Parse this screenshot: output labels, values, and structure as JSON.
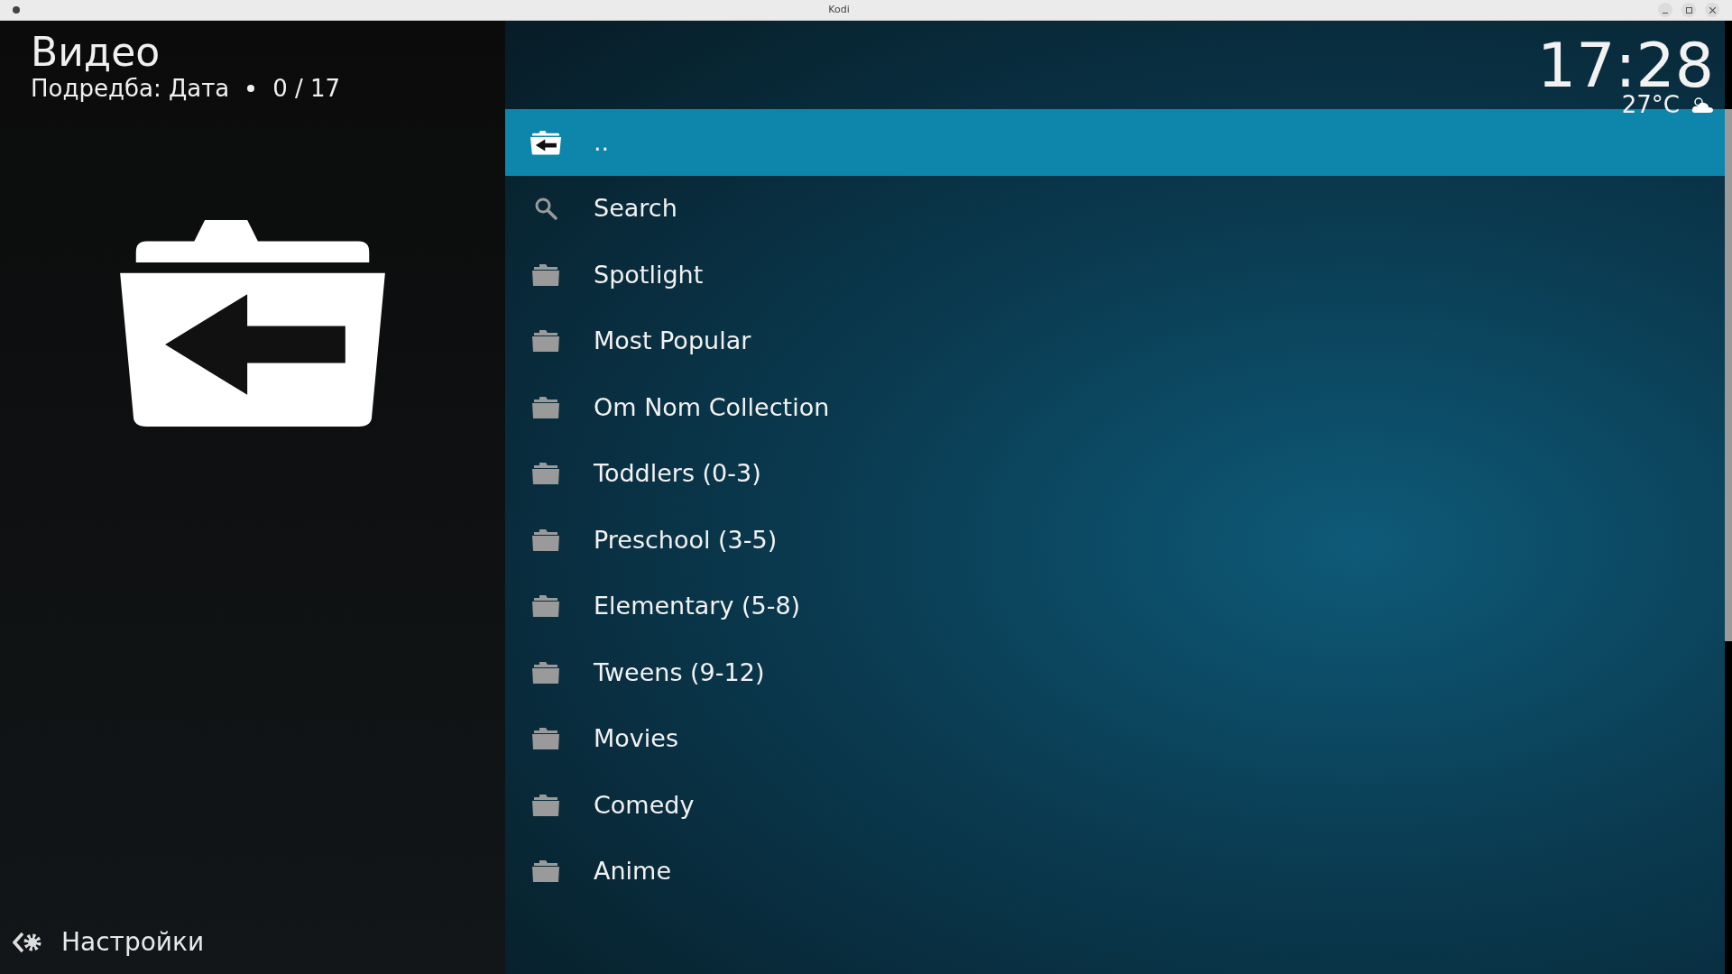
{
  "window": {
    "title": "Kodi"
  },
  "header": {
    "title": "Видео",
    "sort": "Подредба: Дата",
    "count": "0 / 17"
  },
  "clock": {
    "time": "17:28",
    "temperature": "27°C"
  },
  "items": [
    {
      "label": "..",
      "kind": "parent",
      "selected": true
    },
    {
      "label": "Search",
      "kind": "search",
      "selected": false
    },
    {
      "label": "Spotlight",
      "kind": "folder",
      "selected": false
    },
    {
      "label": "Most Popular",
      "kind": "folder",
      "selected": false
    },
    {
      "label": "Om Nom Collection",
      "kind": "folder",
      "selected": false
    },
    {
      "label": "Toddlers (0-3)",
      "kind": "folder",
      "selected": false
    },
    {
      "label": "Preschool (3-5)",
      "kind": "folder",
      "selected": false
    },
    {
      "label": "Elementary (5-8)",
      "kind": "folder",
      "selected": false
    },
    {
      "label": "Tweens (9-12)",
      "kind": "folder",
      "selected": false
    },
    {
      "label": "Movies",
      "kind": "folder",
      "selected": false
    },
    {
      "label": "Comedy",
      "kind": "folder",
      "selected": false
    },
    {
      "label": "Anime",
      "kind": "folder",
      "selected": false
    }
  ],
  "settings": {
    "label": "Настройки"
  }
}
